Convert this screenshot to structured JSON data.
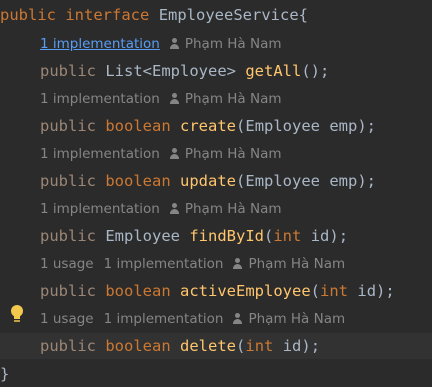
{
  "code": {
    "header": {
      "kw1": "public",
      "kw2": "interface",
      "name": "EmployeeService{"
    },
    "methods": [
      {
        "modifier": "public",
        "ret": "List<Employee>",
        "name": "getAll",
        "params": "",
        "hint": {
          "usages": "",
          "impl": "1 implementation",
          "author": "Phạm Hà Nam"
        }
      },
      {
        "modifier": "public",
        "ret": "boolean",
        "name": "create",
        "params": "Employee emp",
        "hint": {
          "usages": "",
          "impl": "1 implementation",
          "author": "Phạm Hà Nam"
        }
      },
      {
        "modifier": "public",
        "ret": "boolean",
        "name": "update",
        "params": "Employee emp",
        "hint": {
          "usages": "",
          "impl": "1 implementation",
          "author": "Phạm Hà Nam"
        }
      },
      {
        "modifier": "public",
        "ret": "Employee",
        "name": "findById",
        "params_kw": "int",
        "params_name": "id",
        "hint": {
          "usages": "1 implementation",
          "impl": "",
          "author": "Phạm Hà Nam"
        }
      },
      {
        "modifier": "public",
        "ret": "boolean",
        "name": "activeEmployee",
        "params_kw": "int",
        "params_name": "id",
        "hint": {
          "usages": "1 usage",
          "impl": "1 implementation",
          "author": "Phạm Hà Nam"
        }
      },
      {
        "modifier": "public",
        "ret": "boolean",
        "name": "delete",
        "params_kw": "int",
        "params_name": "id",
        "hint": {
          "usages": "1 usage",
          "impl": "1 implementation",
          "author": "Phạm Hà Nam"
        }
      }
    ],
    "closing": "}"
  },
  "colors": {
    "background": "#2b2b2b",
    "keyword": "#cc7832",
    "method": "#ffc66d",
    "text": "#a9b7c6",
    "hint": "#858585",
    "link": "#589df6"
  },
  "icons": {
    "gutter": "lightbulb-icon",
    "author": "person-icon"
  }
}
